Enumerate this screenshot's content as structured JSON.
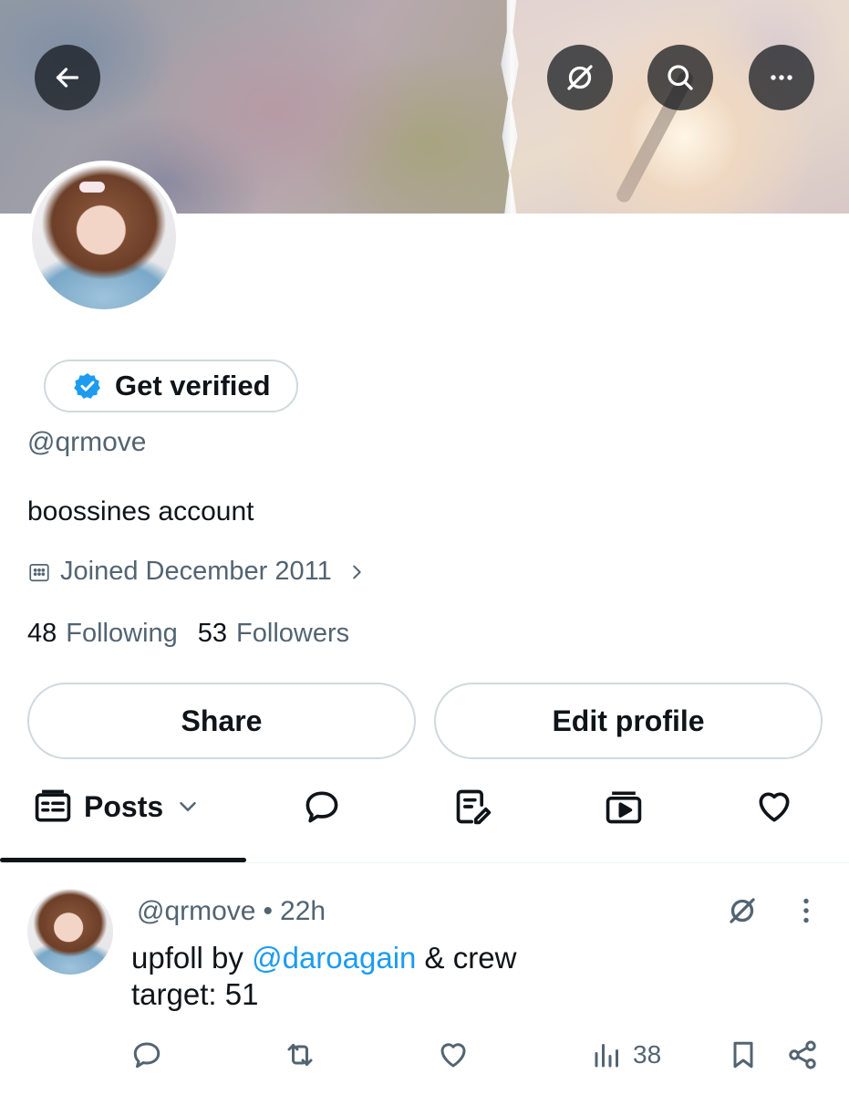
{
  "header": {
    "back_icon": "arrow-left-icon",
    "grok_icon": "grok-icon",
    "search_icon": "search-icon",
    "more_icon": "more-horizontal-icon"
  },
  "profile": {
    "get_verified_label": "Get verified",
    "verified_badge_color": "#1d9bf0",
    "handle": "@qrmove",
    "bio": "boossines account",
    "joined": "Joined December 2011",
    "following_count": "48",
    "following_label": "Following",
    "followers_count": "53",
    "followers_label": "Followers",
    "share_label": "Share",
    "edit_profile_label": "Edit profile"
  },
  "tabs": {
    "posts_label": "Posts",
    "icons": [
      "posts-icon",
      "replies-icon",
      "articles-icon",
      "media-icon",
      "likes-icon"
    ]
  },
  "post": {
    "handle": "@qrmove",
    "separator": "•",
    "time": "22h",
    "text_prefix": "upfoll by ",
    "mention": "@daroagain",
    "text_suffix": " & crew",
    "line2": "target: 51",
    "views": "38",
    "mention_color": "#1d9bf0"
  }
}
